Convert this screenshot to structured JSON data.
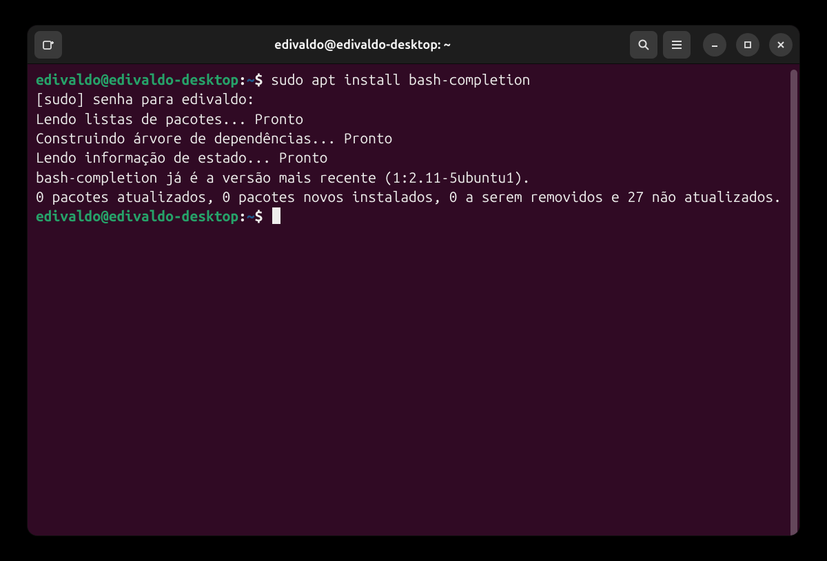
{
  "titlebar": {
    "title": "edivaldo@edivaldo-desktop: ~"
  },
  "prompt": {
    "user_host": "edivaldo@edivaldo-desktop",
    "separator": ":",
    "path": "~",
    "symbol": "$"
  },
  "session": {
    "command": "sudo apt install bash-completion",
    "output_lines": [
      "[sudo] senha para edivaldo: ",
      "Lendo listas de pacotes... Pronto",
      "Construindo árvore de dependências... Pronto",
      "Lendo informação de estado... Pronto",
      "bash-completion já é a versão mais recente (1:2.11-5ubuntu1).",
      "0 pacotes atualizados, 0 pacotes novos instalados, 0 a serem removidos e 27 não atualizados."
    ]
  },
  "icons": {
    "new_tab": "new-tab-icon",
    "search": "search-icon",
    "menu": "hamburger-icon",
    "minimize": "minimize-icon",
    "maximize": "maximize-icon",
    "close": "close-icon"
  },
  "colors": {
    "titlebar_bg": "#1d1d1d",
    "terminal_bg": "#300a24",
    "prompt_user": "#26a269",
    "prompt_path": "#1e5a8c",
    "text": "#eeeeec"
  }
}
